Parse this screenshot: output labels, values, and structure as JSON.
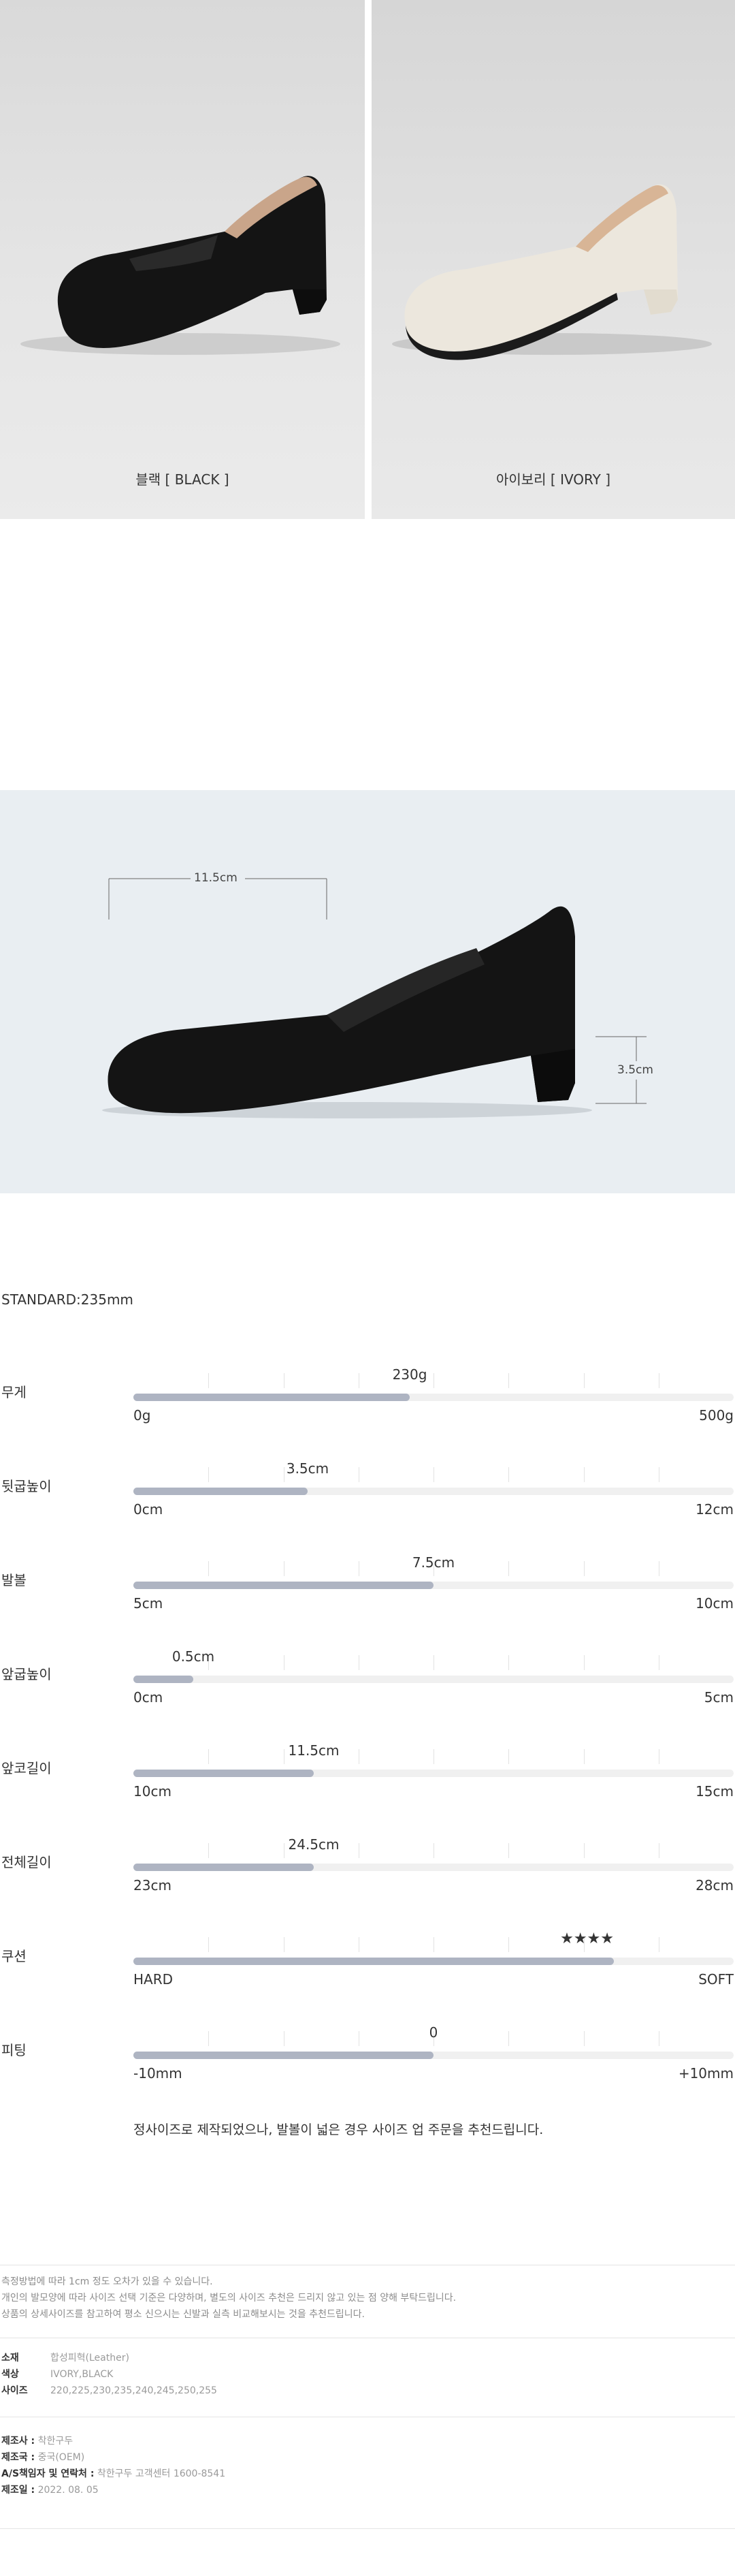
{
  "products": [
    {
      "name": "블랙",
      "code": "[ BLACK ]",
      "color": "#151515"
    },
    {
      "name": "아이보리",
      "code": "[ IVORY ]",
      "color": "#ece7dd"
    }
  ],
  "dimensions": {
    "length": "11.5cm",
    "heel": "3.5cm"
  },
  "standard": "STANDARD:235mm",
  "specs": [
    {
      "name": "무게",
      "value": "230g",
      "min": "0g",
      "max": "500g",
      "fraction": 0.46
    },
    {
      "name": "뒷굽높이",
      "value": "3.5cm",
      "min": "0cm",
      "max": "12cm",
      "fraction": 0.29
    },
    {
      "name": "발볼",
      "value": "7.5cm",
      "min": "5cm",
      "max": "10cm",
      "fraction": 0.5
    },
    {
      "name": "앞굽높이",
      "value": "0.5cm",
      "min": "0cm",
      "max": "5cm",
      "fraction": 0.1
    },
    {
      "name": "앞코길이",
      "value": "11.5cm",
      "min": "10cm",
      "max": "15cm",
      "fraction": 0.3
    },
    {
      "name": "전체길이",
      "value": "24.5cm",
      "min": "23cm",
      "max": "28cm",
      "fraction": 0.3
    },
    {
      "name": "쿠션",
      "value": "★★★★",
      "min": "HARD",
      "max": "SOFT",
      "fraction": 0.8
    },
    {
      "name": "피팅",
      "value": "0",
      "min": "-10mm",
      "max": "+10mm",
      "fraction": 0.5
    }
  ],
  "fit_note": "정사이즈로 제작되었으나, 발볼이 넓은 경우 사이즈 업 주문을 추천드립니다.",
  "disclaimer": [
    "측정방법에 따라 1cm 정도 오차가 있을 수 있습니다.",
    "개인의 발모양에 따라 사이즈 선택 기준은 다양하며, 별도의 사이즈 추천은 드리지 않고 있는 점 양해 부탁드립니다.",
    "상품의 상세사이즈를 참고하여 평소 신으시는 신발과 실측 비교해보시는 것을 추천드립니다."
  ],
  "product_info": [
    {
      "label": "소재",
      "value": "합성피혁(Leather)"
    },
    {
      "label": "색상",
      "value": "IVORY,BLACK"
    },
    {
      "label": "사이즈",
      "value": "220,225,230,235,240,245,250,255"
    }
  ],
  "maker_info": [
    {
      "label": "제조사 :",
      "value": "착한구두"
    },
    {
      "label": "제조국 :",
      "value": "중국(OEM)"
    },
    {
      "label": "A/S책임자 및 연락처 :",
      "value": "착한구두 고객센터 1600-8541"
    },
    {
      "label": "제조일 :",
      "value": "2022. 08. 05"
    }
  ]
}
